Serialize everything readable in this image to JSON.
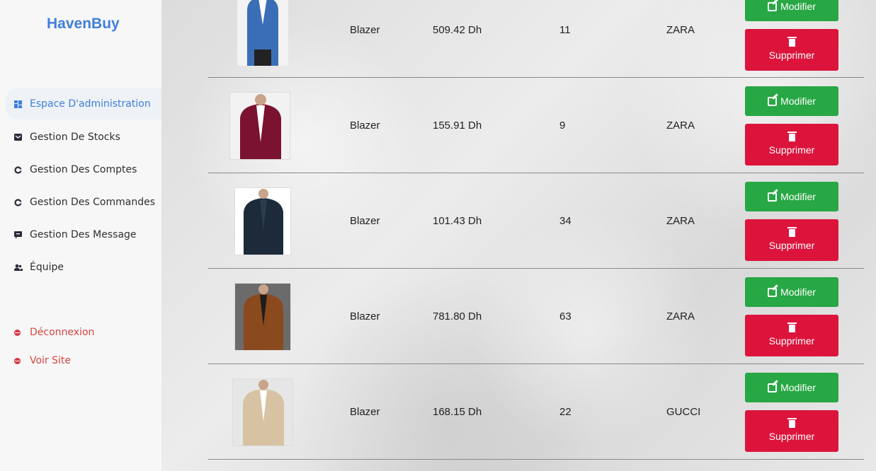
{
  "brand": "HavenBuy",
  "nav": [
    {
      "label": "Espace D'administration",
      "icon": "dashboard-icon",
      "active": true
    },
    {
      "label": "Gestion De Stocks",
      "icon": "box-icon"
    },
    {
      "label": "Gestion Des Comptes",
      "icon": "account-icon"
    },
    {
      "label": "Gestion Des Commandes",
      "icon": "orders-icon"
    },
    {
      "label": "Gestion Des Message",
      "icon": "message-icon"
    },
    {
      "label": "Équipe",
      "icon": "team-icon"
    }
  ],
  "nav_bottom": [
    {
      "label": "Déconnexion",
      "icon": "logout-icon"
    },
    {
      "label": "Voir Site",
      "icon": "view-site-icon"
    }
  ],
  "actions": {
    "edit": "Modifier",
    "delete": "Supprimer"
  },
  "rows": [
    {
      "name": "Blazer",
      "price": "509.42 Dh",
      "qty": "11",
      "brand": "ZARA",
      "color": "#3a6fb8"
    },
    {
      "name": "Blazer",
      "price": "155.91 Dh",
      "qty": "9",
      "brand": "ZARA",
      "color": "#7a1230"
    },
    {
      "name": "Blazer",
      "price": "101.43 Dh",
      "qty": "34",
      "brand": "ZARA",
      "color": "#1c2a3a"
    },
    {
      "name": "Blazer",
      "price": "781.80 Dh",
      "qty": "63",
      "brand": "ZARA",
      "color": "#8a4a1e"
    },
    {
      "name": "Blazer",
      "price": "168.15 Dh",
      "qty": "22",
      "brand": "GUCCI",
      "color": "#d7c3a3"
    }
  ]
}
